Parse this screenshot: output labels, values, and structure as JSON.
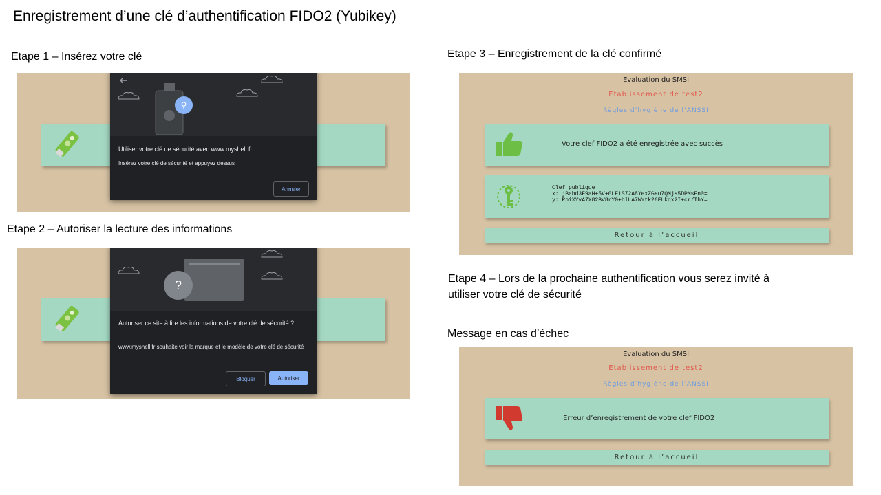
{
  "title": "Enregistrement d’une clé d’authentification FIDO2 (Yubikey)",
  "step1": {
    "label": "Etape 1 – Insérez votre clé",
    "dialog_title": "Utiliser votre clé de sécurité avec www.myshell.fr",
    "dialog_sub": "Insérez votre clé de sécurité et appuyez dessus",
    "cancel_label": "Annuler"
  },
  "step2": {
    "label": "Etape 2 – Autoriser la lecture des informations",
    "dialog_title": "Autoriser ce site à lire les informations de votre clé de sécurité ?",
    "dialog_sub": "www.myshell.fr souhaite voir la marque et le modèle de votre clé de sécurité",
    "block_label": "Bloquer",
    "allow_label": "Autoriser",
    "question_glyph": "?"
  },
  "step3": {
    "label": "Etape 3 – Enregistrement de la clé confirmé",
    "app_title": "Evaluation du SMSI",
    "establishment": "Etablissement de test2",
    "rules": "Règles d’hygiène de l’ANSSI",
    "success_msg": "Votre clef FIDO2 a été enregistrée avec succès",
    "pubkey_label": "Clef publique",
    "pubkey_x": "x: jBahd3F9aH+5V+0LE1S72A8YexZGeu7QMjs5DPMsEn0=",
    "pubkey_y": "y: RpiXYvA7X82BV8rY0+blLA7WYtk26FLkqx2I+cr/IhY=",
    "return_label": "Retour à l’accueil"
  },
  "step4": {
    "label_line1": "Etape 4 – Lors de la prochaine authentification vous serez invité à",
    "label_line2": "utiliser votre clé de sécurité"
  },
  "failure": {
    "label": "Message en cas d’échec",
    "app_title": "Evaluation du SMSI",
    "establishment": "Etablissement de test2",
    "rules": "Règles d’hygiène de l’ANSSI",
    "error_msg": "Erreur d’enregistrement de votre clef FIDO2",
    "return_label": "Retour à l’accueil"
  },
  "colors": {
    "panel": "#d7c2a3",
    "teal": "#a4d8c3",
    "establishment_red": "#e05a4e",
    "rules_blue": "#6a9be0",
    "thumb_green": "#6cbe45",
    "thumb_red": "#d03a2f",
    "dialog_bg": "#202124",
    "accent_blue": "#8ab4f8"
  },
  "icons": [
    "back-arrow-icon",
    "usb-key-icon",
    "usb-symbol-icon",
    "cloud-icon",
    "yubikey-icon",
    "question-icon",
    "folder-icon",
    "thumbs-up-icon",
    "thumbs-down-icon",
    "key-circuit-icon"
  ]
}
